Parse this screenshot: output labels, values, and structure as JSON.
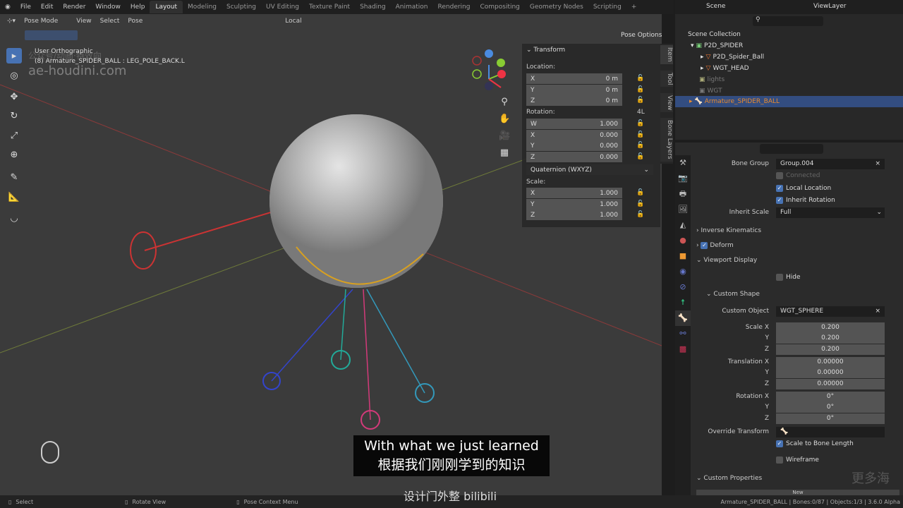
{
  "menu": {
    "items": [
      "File",
      "Edit",
      "Render",
      "Window",
      "Help"
    ],
    "workspaces": [
      "Layout",
      "Modeling",
      "Sculpting",
      "UV Editing",
      "Texture Paint",
      "Shading",
      "Animation",
      "Rendering",
      "Compositing",
      "Geometry Nodes",
      "Scripting",
      "+"
    ],
    "active_workspace": "Layout"
  },
  "scene": {
    "scene": "Scene",
    "view_layer": "ViewLayer"
  },
  "viewport_header": {
    "mode": "Pose Mode",
    "menus": [
      "View",
      "Select",
      "Pose"
    ],
    "orientation": "Local",
    "pose_options": "Pose Options"
  },
  "viewport": {
    "view_name": "User Orthographic",
    "object_info": "(8) Armature_SPIDER_BALL : LEG_POLE_BACK.L",
    "watermark": "ae-houdini.com",
    "watermark_cn": "公众号/动画·特效向",
    "gizmo": {
      "x": "X",
      "y": "Y",
      "z": "Z"
    }
  },
  "npanel": {
    "title": "Transform",
    "location_label": "Location:",
    "location": [
      {
        "axis": "X",
        "value": "0 m"
      },
      {
        "axis": "Y",
        "value": "0 m"
      },
      {
        "axis": "Z",
        "value": "0 m"
      }
    ],
    "rotation_label": "Rotation:",
    "rotation_flag": "4L",
    "rotation": [
      {
        "axis": "W",
        "value": "1.000"
      },
      {
        "axis": "X",
        "value": "0.000"
      },
      {
        "axis": "Y",
        "value": "0.000"
      },
      {
        "axis": "Z",
        "value": "0.000"
      }
    ],
    "rotation_mode": "Quaternion (WXYZ)",
    "scale_label": "Scale:",
    "scale": [
      {
        "axis": "X",
        "value": "1.000"
      },
      {
        "axis": "Y",
        "value": "1.000"
      },
      {
        "axis": "Z",
        "value": "1.000"
      }
    ],
    "tabs": [
      "Item",
      "Tool",
      "View",
      "Bone Layers"
    ]
  },
  "outliner": {
    "items": [
      "Scene Collection",
      "P2D_SPIDER",
      "P2D_Spider_Ball",
      "WGT_HEAD",
      "lights",
      "WGT",
      "Armature_SPIDER_BALL"
    ]
  },
  "props": {
    "bone_group_label": "Bone Group",
    "bone_group": "Group.004",
    "connected": "Connected",
    "local_location": "Local Location",
    "inherit_rotation": "Inherit Rotation",
    "inherit_scale_label": "Inherit Scale",
    "inherit_scale": "Full",
    "inverse_kinematics": "Inverse Kinematics",
    "deform": "Deform",
    "viewport_display": "Viewport Display",
    "hide": "Hide",
    "custom_shape": "Custom Shape",
    "custom_object_label": "Custom Object",
    "custom_object": "WGT_SPHERE",
    "scale_label": "Scale X",
    "translation_label": "Translation X",
    "rotation_label": "Rotation X",
    "y": "Y",
    "z": "Z",
    "scale": [
      "0.200",
      "0.200",
      "0.200"
    ],
    "translation": [
      "0.00000",
      "0.00000",
      "0.00000"
    ],
    "rotation": [
      "0°",
      "0°",
      "0°"
    ],
    "override_transform": "Override Transform",
    "scale_to_bone_length": "Scale to Bone Length",
    "wireframe": "Wireframe",
    "custom_properties": "Custom Properties",
    "new": "New"
  },
  "status": {
    "select": "Select",
    "rotate": "Rotate View",
    "context": "Pose Context Menu",
    "info": "Armature_SPIDER_BALL | Bones:0/87 | Objects:1/3 | 3.6.0 Alpha"
  },
  "subtitles": {
    "en": "With what we just learned",
    "zh": "根据我们刚刚学到的知识"
  },
  "watermarks": {
    "bottom": "设计门外整 bilibili",
    "corner": "更多海"
  }
}
